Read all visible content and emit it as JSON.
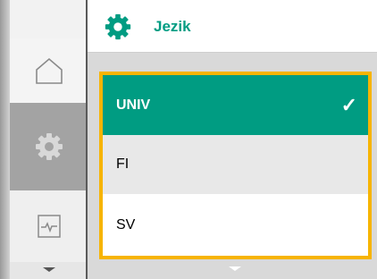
{
  "header": {
    "title": "Jezik",
    "icon": "gear-icon",
    "accent_color": "#009c82"
  },
  "sidebar": {
    "items": [
      {
        "icon": "home-icon",
        "active": false
      },
      {
        "icon": "gear-icon",
        "active": true
      },
      {
        "icon": "monitor-graph-icon",
        "active": false
      }
    ]
  },
  "language_list": {
    "highlight_color": "#f7b400",
    "items": [
      {
        "label": "UNIV",
        "selected": true,
        "icon": "checkmark-icon"
      },
      {
        "label": "FI",
        "selected": false
      },
      {
        "label": "SV",
        "selected": false
      }
    ],
    "check_glyph": "✓"
  }
}
